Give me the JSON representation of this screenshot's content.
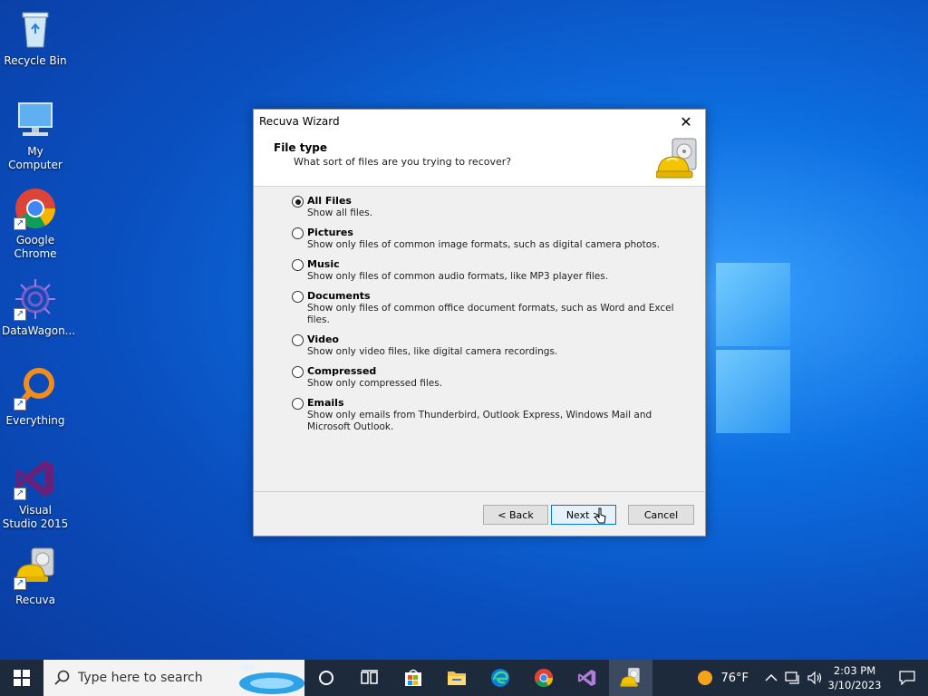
{
  "desktop": {
    "icons": [
      {
        "label": "Recycle Bin"
      },
      {
        "label": "My Computer"
      },
      {
        "label": "Google Chrome"
      },
      {
        "label": "DataWagon..."
      },
      {
        "label": "Everything"
      },
      {
        "label": "Visual Studio 2015"
      },
      {
        "label": "Recuva"
      }
    ]
  },
  "dialog": {
    "title": "Recuva Wizard",
    "header_title": "File type",
    "header_subtitle": "What sort of files are you trying to recover?",
    "options": [
      {
        "label": "All Files",
        "desc": "Show all files.",
        "selected": true
      },
      {
        "label": "Pictures",
        "desc": "Show only files of common image formats, such as digital camera photos.",
        "selected": false
      },
      {
        "label": "Music",
        "desc": "Show only files of common audio formats, like MP3 player files.",
        "selected": false
      },
      {
        "label": "Documents",
        "desc": "Show only files of common office document formats, such as Word and Excel files.",
        "selected": false
      },
      {
        "label": "Video",
        "desc": "Show only video files, like digital camera recordings.",
        "selected": false
      },
      {
        "label": "Compressed",
        "desc": "Show only compressed files.",
        "selected": false
      },
      {
        "label": "Emails",
        "desc": "Show only emails from Thunderbird, Outlook Express, Windows Mail and Microsoft Outlook.",
        "selected": false
      }
    ],
    "back_label": "< Back",
    "next_label": "Next >",
    "cancel_label": "Cancel"
  },
  "taskbar": {
    "search_placeholder": "Type here to search",
    "weather": "76°F",
    "time": "2:03 PM",
    "date": "3/10/2023"
  }
}
